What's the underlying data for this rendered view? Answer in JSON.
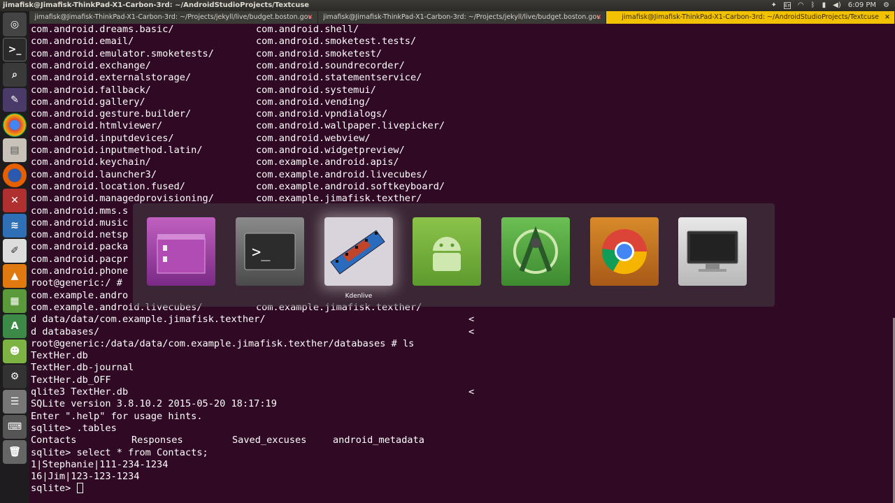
{
  "window": {
    "title": "jimafisk@Jimafisk-ThinkPad-X1-Carbon-3rd: ~/AndroidStudioProjects/Textcuse",
    "clock": "6:09 PM"
  },
  "tabs": [
    {
      "label": "jimafisk@Jimafisk-ThinkPad-X1-Carbon-3rd: ~/Projects/jekyll/live/budget.boston.gov",
      "active": false
    },
    {
      "label": "jimafisk@Jimafisk-ThinkPad-X1-Carbon-3rd: ~/Projects/jekyll/live/budget.boston.gov",
      "active": false
    },
    {
      "label": "jimafisk@Jimafisk-ThinkPad-X1-Carbon-3rd: ~/AndroidStudioProjects/Textcuse",
      "active": true
    }
  ],
  "launcher": [
    "dash-icon",
    "terminal-icon",
    "search-icon",
    "kdenlive-icon",
    "chrome-icon",
    "files-icon",
    "firefox-icon",
    "tools-icon",
    "monitor-icon",
    "text-editor-icon",
    "vlc-icon",
    "spreadsheet-icon",
    "android-studio-icon",
    "android-icon",
    "settings-icon",
    "server-icon",
    "keyboard-icon",
    "trash-icon"
  ],
  "terminal": {
    "listing": [
      [
        "com.android.dreams.basic/",
        "com.android.shell/"
      ],
      [
        "com.android.email/",
        "com.android.smoketest.tests/"
      ],
      [
        "com.android.emulator.smoketests/",
        "com.android.smoketest/"
      ],
      [
        "com.android.exchange/",
        "com.android.soundrecorder/"
      ],
      [
        "com.android.externalstorage/",
        "com.android.statementservice/"
      ],
      [
        "com.android.fallback/",
        "com.android.systemui/"
      ],
      [
        "com.android.gallery/",
        "com.android.vending/"
      ],
      [
        "com.android.gesture.builder/",
        "com.android.vpndialogs/"
      ],
      [
        "com.android.htmlviewer/",
        "com.android.wallpaper.livepicker/"
      ],
      [
        "com.android.inputdevices/",
        "com.android.webview/"
      ],
      [
        "com.android.inputmethod.latin/",
        "com.android.widgetpreview/"
      ],
      [
        "com.android.keychain/",
        "com.example.android.apis/"
      ],
      [
        "com.android.launcher3/",
        "com.example.android.livecubes/"
      ],
      [
        "com.android.location.fused/",
        "com.example.android.softkeyboard/"
      ],
      [
        "com.android.managedprovisioning/",
        "com.example.jimafisk.texther/"
      ]
    ],
    "partial": [
      "com.android.mms.s",
      "com.android.music",
      "com.android.netsp",
      "com.android.packa",
      "com.android.pacpr",
      "com.android.phone",
      "root@generic:/ #",
      "com.example.andro"
    ],
    "after_livecubes": [
      "com.example.android.livecubes/",
      "com.example.jimafisk.texther/"
    ],
    "cd_line_1": "d data/data/com.example.jimafisk.texther/",
    "cd_line_2": "d databases/",
    "ls_prompt": "root@generic:/data/data/com.example.jimafisk.texther/databases # ls",
    "files": [
      "TextHer.db",
      "TextHer.db-journal",
      "TextHer.db_OFF"
    ],
    "sqlite_cmd": "qlite3 TextHer.db",
    "sqlite_version": "SQLite version 3.8.10.2 2015-05-20 18:17:19",
    "help_hint": "Enter \".help\" for usage hints.",
    "tables_cmd": "sqlite> .tables",
    "tables": [
      "Contacts",
      "Responses",
      "Saved_excuses",
      "android_metadata"
    ],
    "select_cmd": "sqlite> select * from Contacts;",
    "rows": [
      "1|Stephanie|111-234-1234",
      "16|Jim|123-123-1234"
    ],
    "prompt": "sqlite> ",
    "overflow_mark": "<"
  },
  "switcher": {
    "apps": [
      "files-icon",
      "terminal-icon",
      "kdenlive-icon",
      "android-icon",
      "android-studio-icon",
      "chrome-icon",
      "display-icon"
    ],
    "selected_label": "Kdenlive"
  }
}
